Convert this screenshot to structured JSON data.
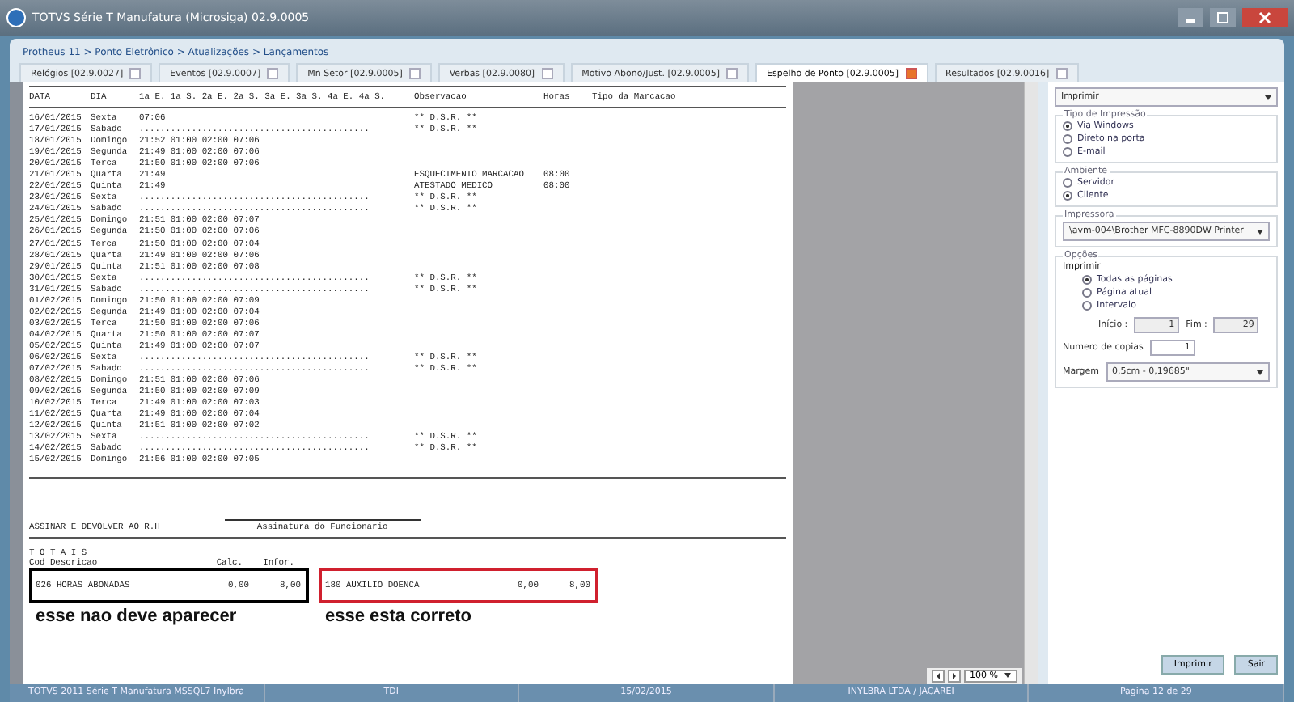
{
  "window": {
    "title": "TOTVS Série T Manufatura (Microsiga) 02.9.0005"
  },
  "breadcrumb": "Protheus 11 > Ponto Eletrônico > Atualizações > Lançamentos",
  "tabs": [
    {
      "label": "Relógios [02.9.0027]",
      "selected": false
    },
    {
      "label": "Eventos [02.9.0007]",
      "selected": false
    },
    {
      "label": "Mn Setor [02.9.0005]",
      "selected": false
    },
    {
      "label": "Verbas [02.9.0080]",
      "selected": false
    },
    {
      "label": "Motivo Abono/Just. [02.9.0005]",
      "selected": false
    },
    {
      "label": "Espelho de Ponto [02.9.0005]",
      "selected": true
    },
    {
      "label": "Resultados [02.9.0016]",
      "selected": false
    }
  ],
  "report": {
    "header": [
      "DATA",
      "DIA",
      "1a E.",
      "1a S.",
      "2a E.",
      "2a S.",
      "3a E.",
      "3a S.",
      "4a E.",
      "4a S.",
      "Observacao",
      "Horas",
      "Tipo da Marcacao"
    ],
    "rows": [
      {
        "date": "16/01/2015",
        "day": "Sexta",
        "marks": "07:06",
        "obs": "** D.S.R. **",
        "hours": ""
      },
      {
        "date": "17/01/2015",
        "day": "Sabado",
        "marks": "............................................",
        "obs": "** D.S.R. **",
        "hours": ""
      },
      {
        "date": "18/01/2015",
        "day": "Domingo",
        "marks": "21:52 01:00 02:00 07:06",
        "obs": "",
        "hours": ""
      },
      {
        "date": "19/01/2015",
        "day": "Segunda",
        "marks": "21:49 01:00 02:00 07:06",
        "obs": "",
        "hours": ""
      },
      {
        "date": "20/01/2015",
        "day": "Terca",
        "marks": "21:50 01:00 02:00 07:06",
        "obs": "",
        "hours": ""
      },
      {
        "date": "21/01/2015",
        "day": "Quarta",
        "marks": "21:49",
        "obs": "ESQUECIMENTO MARCACAO",
        "hours": "08:00"
      },
      {
        "date": "22/01/2015",
        "day": "Quinta",
        "marks": "21:49",
        "obs": "ATESTADO MEDICO",
        "hours": "08:00"
      },
      {
        "date": "23/01/2015",
        "day": "Sexta",
        "marks": "............................................",
        "obs": "** D.S.R. **",
        "hours": ""
      },
      {
        "date": "24/01/2015",
        "day": "Sabado",
        "marks": "............................................",
        "obs": "** D.S.R. **",
        "hours": ""
      },
      {
        "date": "25/01/2015",
        "day": "Domingo",
        "marks": "21:51 01:00 02:00 07:07",
        "obs": "",
        "hours": ""
      },
      {
        "date": "26/01/2015",
        "day": "Segunda",
        "marks": "21:50 01:00 02:00 07:06",
        "obs": "",
        "hours": ""
      },
      {
        "date": "27/01/2015",
        "day": "Terca",
        "marks": "21:50 01:00 02:00 07:04",
        "obs": "",
        "hours": ""
      },
      {
        "date": "28/01/2015",
        "day": "Quarta",
        "marks": "21:49 01:00 02:00 07:06",
        "obs": "",
        "hours": ""
      },
      {
        "date": "29/01/2015",
        "day": "Quinta",
        "marks": "21:51 01:00 02:00 07:08",
        "obs": "",
        "hours": ""
      },
      {
        "date": "30/01/2015",
        "day": "Sexta",
        "marks": "............................................",
        "obs": "** D.S.R. **",
        "hours": ""
      },
      {
        "date": "31/01/2015",
        "day": "Sabado",
        "marks": "............................................",
        "obs": "** D.S.R. **",
        "hours": ""
      },
      {
        "date": "01/02/2015",
        "day": "Domingo",
        "marks": "21:50 01:00 02:00 07:09",
        "obs": "",
        "hours": ""
      },
      {
        "date": "02/02/2015",
        "day": "Segunda",
        "marks": "21:49 01:00 02:00 07:04",
        "obs": "",
        "hours": ""
      },
      {
        "date": "03/02/2015",
        "day": "Terca",
        "marks": "21:50 01:00 02:00 07:06",
        "obs": "",
        "hours": ""
      },
      {
        "date": "04/02/2015",
        "day": "Quarta",
        "marks": "21:50 01:00 02:00 07:07",
        "obs": "",
        "hours": ""
      },
      {
        "date": "05/02/2015",
        "day": "Quinta",
        "marks": "21:49 01:00 02:00 07:07",
        "obs": "",
        "hours": ""
      },
      {
        "date": "06/02/2015",
        "day": "Sexta",
        "marks": "............................................",
        "obs": "** D.S.R. **",
        "hours": ""
      },
      {
        "date": "07/02/2015",
        "day": "Sabado",
        "marks": "............................................",
        "obs": "** D.S.R. **",
        "hours": ""
      },
      {
        "date": "08/02/2015",
        "day": "Domingo",
        "marks": "21:51 01:00 02:00 07:06",
        "obs": "",
        "hours": ""
      },
      {
        "date": "09/02/2015",
        "day": "Segunda",
        "marks": "21:50 01:00 02:00 07:09",
        "obs": "",
        "hours": ""
      },
      {
        "date": "10/02/2015",
        "day": "Terca",
        "marks": "21:49 01:00 02:00 07:03",
        "obs": "",
        "hours": ""
      },
      {
        "date": "11/02/2015",
        "day": "Quarta",
        "marks": "21:49 01:00 02:00 07:04",
        "obs": "",
        "hours": ""
      },
      {
        "date": "12/02/2015",
        "day": "Quinta",
        "marks": "21:51 01:00 02:00 07:02",
        "obs": "",
        "hours": ""
      },
      {
        "date": "13/02/2015",
        "day": "Sexta",
        "marks": "............................................",
        "obs": "** D.S.R. **",
        "hours": ""
      },
      {
        "date": "14/02/2015",
        "day": "Sabado",
        "marks": "............................................",
        "obs": "** D.S.R. **",
        "hours": ""
      },
      {
        "date": "15/02/2015",
        "day": "Domingo",
        "marks": "21:56 01:00 02:00 07:05",
        "obs": "",
        "hours": ""
      }
    ],
    "sign_note": "ASSINAR E DEVOLVER AO R.H",
    "signature_label": "Assinatura do Funcionario",
    "totals_title": "T O T A I S",
    "totals_header": [
      "Cod Descricao",
      "Calc.",
      "Infor."
    ],
    "totals": [
      {
        "desc": "026 HORAS ABONADAS",
        "calc": "0,00",
        "infor": "8,00",
        "annotation": "esse nao deve aparecer",
        "color": "#000000"
      },
      {
        "desc": "180 AUXILIO DOENCA",
        "calc": "0,00",
        "infor": "8,00",
        "annotation": "esse esta correto",
        "color": "#d0202e"
      }
    ],
    "zoom": "100 %"
  },
  "print_panel": {
    "action": "Imprimir",
    "groups": [
      {
        "title": "Tipo de Impressão",
        "kind": "radios",
        "options": [
          {
            "label": "Via Windows",
            "selected": true
          },
          {
            "label": "Direto na porta",
            "selected": false
          },
          {
            "label": "E-mail",
            "selected": false
          }
        ]
      },
      {
        "title": "Ambiente",
        "kind": "radios",
        "options": [
          {
            "label": "Servidor",
            "selected": false
          },
          {
            "label": "Cliente",
            "selected": true
          }
        ]
      },
      {
        "title": "Impressora",
        "kind": "select",
        "value": "\\avm-004\\Brother MFC-8890DW Printer"
      }
    ],
    "options": {
      "title": "Opções",
      "subtitle": "Imprimir",
      "pages": [
        {
          "label": "Todas as páginas",
          "selected": true
        },
        {
          "label": "Página atual",
          "selected": false
        },
        {
          "label": "Intervalo",
          "selected": false
        }
      ],
      "start_label": "Início :",
      "start": "1",
      "end_label": "Fim :",
      "end": "29",
      "copies_label": "Numero de copias",
      "copies": "1",
      "margin_label": "Margem",
      "margin": "0,5cm - 0,19685\""
    },
    "buttons": [
      "Imprimir",
      "Sair"
    ]
  },
  "status_bar": [
    "TOTVS 2011 Série T Manufatura MSSQL7 Inylbra",
    "TDI",
    "15/02/2015",
    "INYLBRA LTDA / JACAREI",
    "Pagina 12 de 29"
  ]
}
